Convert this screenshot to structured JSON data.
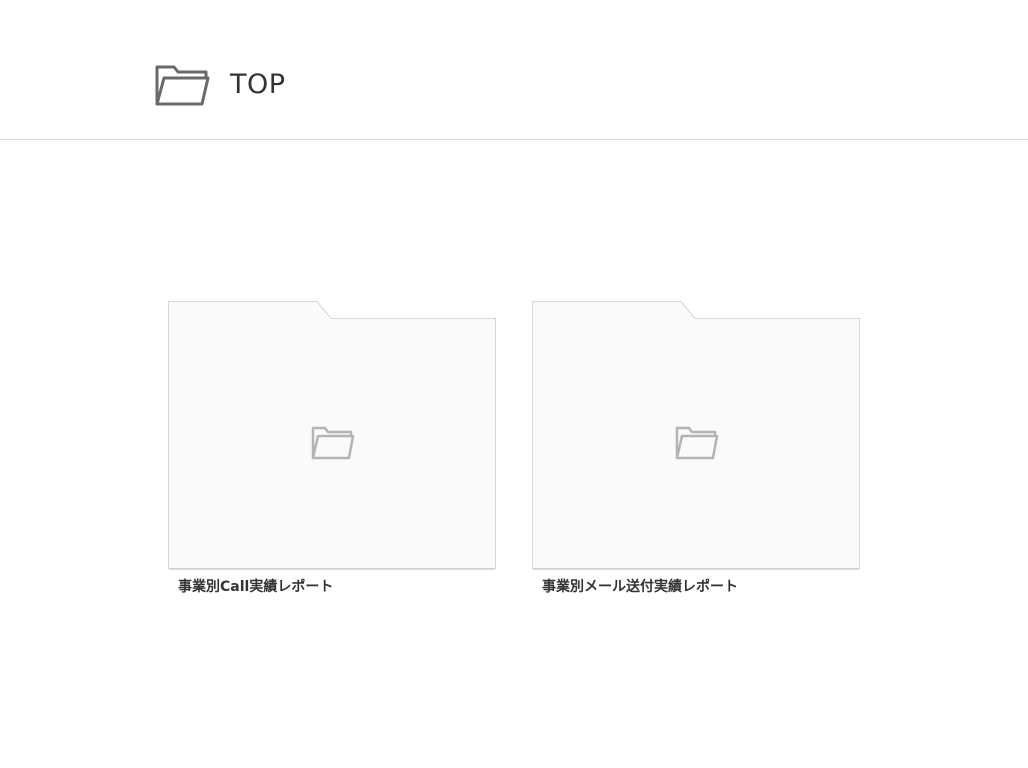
{
  "header": {
    "icon": "folder-open-icon",
    "title": "TOP"
  },
  "folders": [
    {
      "icon": "folder-open-icon",
      "label": "事業別Call実績レポート"
    },
    {
      "icon": "folder-open-icon",
      "label": "事業別メール送付実績レポート"
    }
  ],
  "colors": {
    "folder_fill": "#fafafa",
    "folder_border": "#d6d6d6",
    "icon_gray": "#b4b4b4",
    "header_icon": "#6a6a6a",
    "text": "#333333"
  }
}
